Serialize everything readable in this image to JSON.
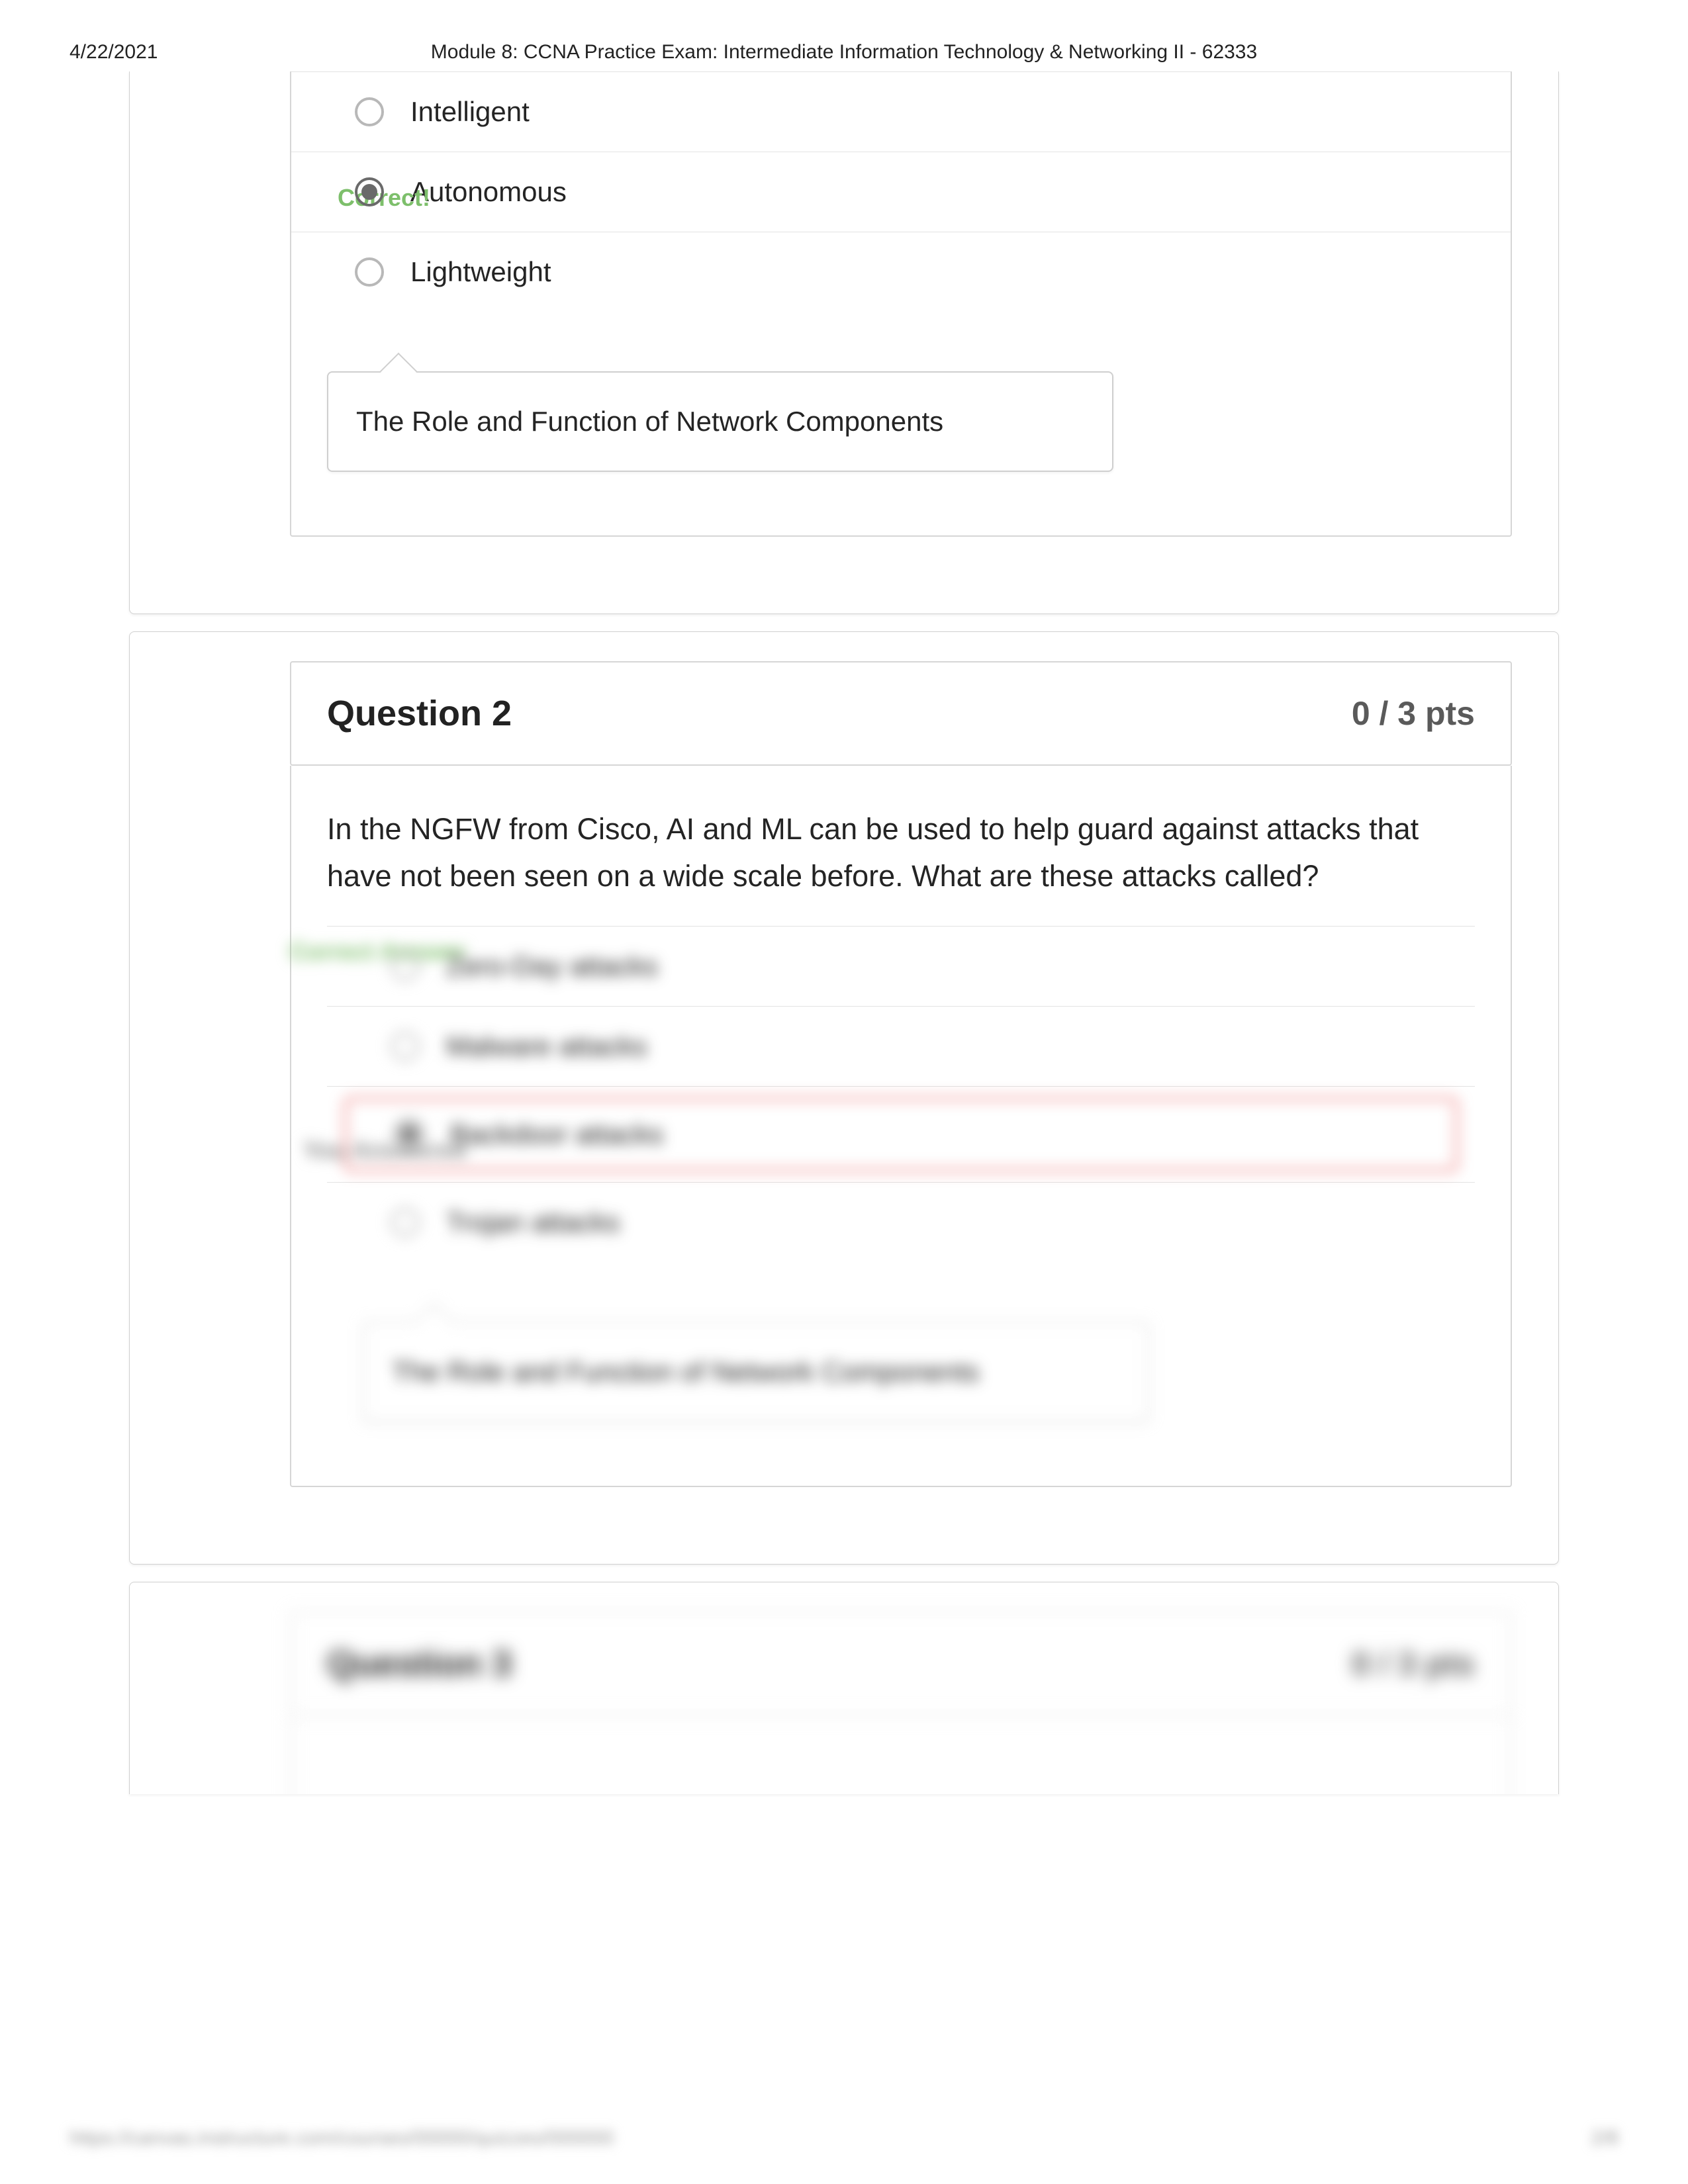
{
  "header": {
    "date": "4/22/2021",
    "title": "Module 8: CCNA Practice Exam: Intermediate Information Technology & Networking II - 62333"
  },
  "footer": {
    "url_blurred": "https://canvas.instructure.com/courses/00000/quizzes/000000",
    "page_blurred": "2/8"
  },
  "q1_partial": {
    "side_label": "Correct!",
    "options": [
      {
        "label": "Intelligent",
        "selected": false
      },
      {
        "label": "Autonomous",
        "selected": true
      },
      {
        "label": "Lightweight",
        "selected": false
      }
    ],
    "topic": "The Role and Function of Network Components"
  },
  "q2": {
    "title": "Question 2",
    "points": "0 / 3 pts",
    "text": "In the NGFW from Cisco, AI and ML can be used to help guard against attacks that have not been seen on a wide scale before. What are these attacks called?",
    "side_correct": "Correct Answer",
    "side_you": "You Answered",
    "options": [
      {
        "label": "Zero-Day attacks",
        "state": "correct"
      },
      {
        "label": "Malware attacks",
        "state": "normal"
      },
      {
        "label": "Backdoor attacks",
        "state": "you"
      },
      {
        "label": "Trojan attacks",
        "state": "normal"
      }
    ],
    "topic": "The Role and Function of Network Components"
  },
  "q3_partial": {
    "title": "Question 3",
    "points": "0 / 3 pts"
  }
}
